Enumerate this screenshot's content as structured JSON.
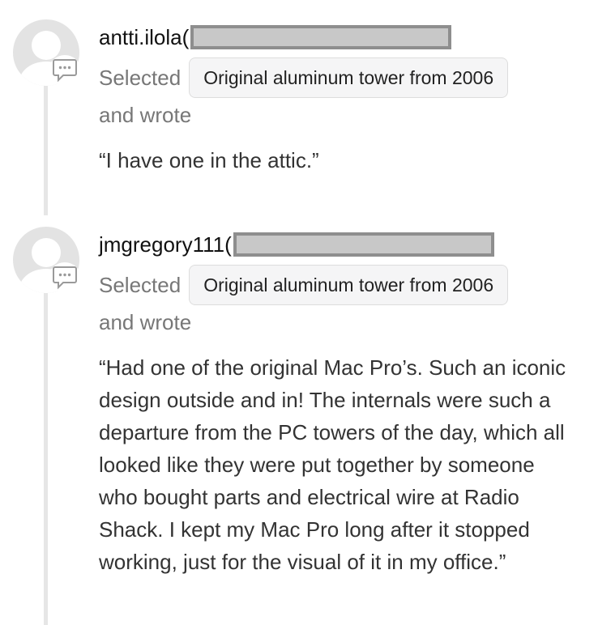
{
  "comments": [
    {
      "author": "antti.ilola(",
      "selected_label": "Selected",
      "option": "Original aluminum tower from 2006",
      "wrote_label": "and wrote",
      "quote": "“I have one in the attic.”"
    },
    {
      "author": "jmgregory111(",
      "selected_label": "Selected",
      "option": "Original aluminum tower from 2006",
      "wrote_label": "and wrote",
      "quote": "“Had one of the original Mac Pro’s. Such an iconic design outside and in! The internals were such a departure from the PC towers of the day, which all looked like they were put together by someone who bought parts and electrical wire at Radio Shack. I kept my Mac Pro long after it stopped working, just for the visual of it in my office.”"
    }
  ],
  "icons": {
    "avatar": "default-avatar-icon",
    "comment": "speech-bubble-icon"
  },
  "colors": {
    "avatar_bg": "#e3e3e3",
    "muted_text": "#777777",
    "chip_bg": "#f5f5f6",
    "redaction_fill": "#c8c8c8",
    "redaction_border": "#8e8e8e"
  }
}
